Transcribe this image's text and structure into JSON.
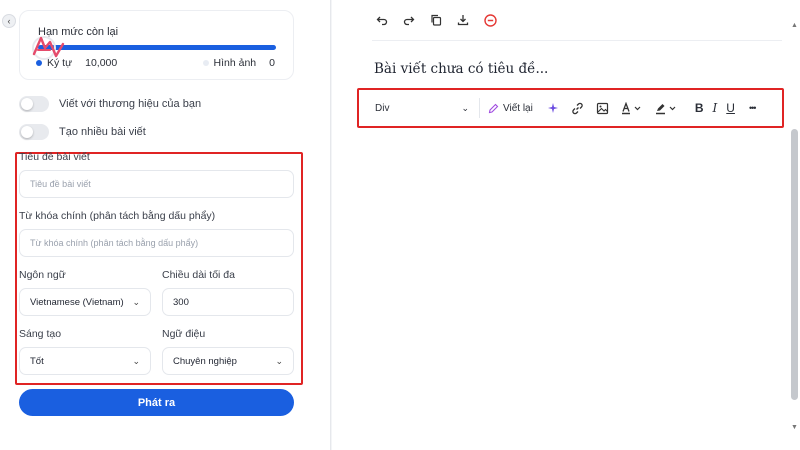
{
  "quota": {
    "title": "Hạn mức còn lại",
    "characters_label": "Ký tự",
    "characters_value": "10,000",
    "images_label": "Hình ảnh",
    "images_value": "0",
    "bar_fill_fraction": 1.0
  },
  "toggles": {
    "brand_voice": "Viết với thương hiệu của bạn",
    "multi_article": "Tạo nhiều bài viết"
  },
  "form": {
    "title_label": "Tiêu đề bài viết",
    "title_placeholder": "Tiêu đề bài viết",
    "keyword_label": "Từ khóa chính (phân tách bằng dấu phẩy)",
    "keyword_placeholder": "Từ khóa chính (phân tách bằng dấu phẩy)",
    "language_label": "Ngôn ngữ",
    "language_value": "Vietnamese (Vietnam)",
    "max_length_label": "Chiều dài tối đa",
    "max_length_value": "300",
    "creativity_label": "Sáng tạo",
    "creativity_value": "Tốt",
    "tone_label": "Ngữ điệu",
    "tone_value": "Chuyên nghiệp",
    "submit_label": "Phát ra"
  },
  "editor": {
    "doc_title": "Bài viết chưa có tiêu đề...",
    "block_type": "Div",
    "rewrite_label": "Viết lại",
    "bold": "B",
    "italic": "I",
    "underline": "U",
    "more": "•••"
  },
  "colors": {
    "accent": "#1a5fe0",
    "highlight_frame": "#e02424",
    "danger_icon": "#e53935"
  }
}
